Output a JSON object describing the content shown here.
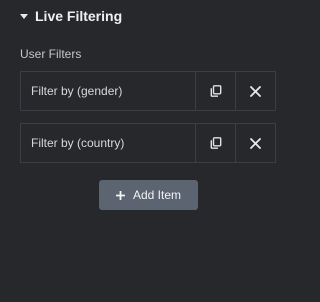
{
  "section": {
    "title": "Live Filtering",
    "caret_icon": "caret-down-icon"
  },
  "field": {
    "label": "User Filters"
  },
  "items": [
    {
      "title": "Filter by (gender)",
      "duplicate_icon": "duplicate-icon",
      "remove_icon": "close-icon"
    },
    {
      "title": "Filter by (country)",
      "duplicate_icon": "duplicate-icon",
      "remove_icon": "close-icon"
    }
  ],
  "add_button": {
    "label": "Add Item",
    "icon": "plus-icon"
  },
  "colors": {
    "background": "#26282b",
    "border": "#3b3e43",
    "button": "#5b6470"
  }
}
